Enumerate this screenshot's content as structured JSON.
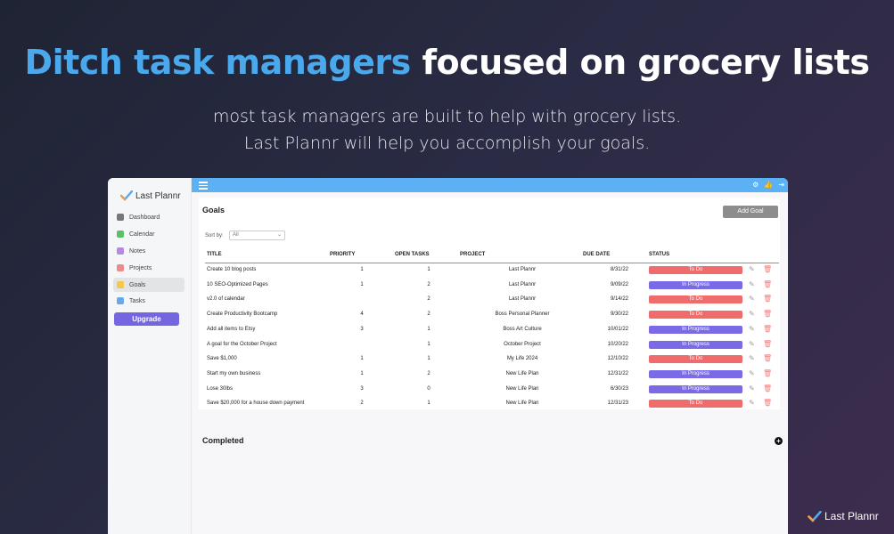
{
  "hero": {
    "headline_accent": "Ditch task managers",
    "headline_rest": "focused on grocery lists",
    "subline_1": "most task managers are built to help with grocery lists.",
    "subline_2": "Last Plannr will help you accomplish your goals."
  },
  "app": {
    "logo_text": "Last Plannr",
    "sidebar": {
      "items": [
        {
          "label": "Dashboard",
          "icon": "home-icon",
          "color": "#777777"
        },
        {
          "label": "Calendar",
          "icon": "calendar-icon",
          "color": "#5cc06a"
        },
        {
          "label": "Notes",
          "icon": "notes-icon",
          "color": "#b48be0"
        },
        {
          "label": "Projects",
          "icon": "projects-icon",
          "color": "#ef8a8a"
        },
        {
          "label": "Goals",
          "icon": "goals-icon",
          "color": "#f3c94a"
        },
        {
          "label": "Tasks",
          "icon": "tasks-icon",
          "color": "#6aa9e8"
        }
      ],
      "active": "Goals",
      "upgrade_label": "Upgrade"
    },
    "topbar": {
      "icons": [
        "settings-icon",
        "thumbs-up-icon",
        "logout-icon"
      ]
    },
    "goals": {
      "title": "Goals",
      "add_label": "Add Goal",
      "sort_label": "Sort by:",
      "sort_value": "All",
      "columns": {
        "title": "TITLE",
        "priority": "PRIORITY",
        "open_tasks": "OPEN TASKS",
        "project": "PROJECT",
        "due_date": "DUE DATE",
        "status": "STATUS"
      },
      "rows": [
        {
          "title": "Create 10 blog posts",
          "priority": "1",
          "open": "1",
          "project": "Last Plannr",
          "due": "8/31/22",
          "status": "To Do"
        },
        {
          "title": "10 SEO-Optimized Pages",
          "priority": "1",
          "open": "2",
          "project": "Last Plannr",
          "due": "9/09/22",
          "status": "In Progress"
        },
        {
          "title": "v2.0 of calendar",
          "priority": "",
          "open": "2",
          "project": "Last Plannr",
          "due": "9/14/22",
          "status": "To Do"
        },
        {
          "title": "Create Productivity Bootcamp",
          "priority": "4",
          "open": "2",
          "project": "Boss Personal Planner",
          "due": "9/30/22",
          "status": "To Do"
        },
        {
          "title": "Add all items to Etsy",
          "priority": "3",
          "open": "1",
          "project": "Boss Art Culture",
          "due": "10/01/22",
          "status": "In Progress"
        },
        {
          "title": "A goal for the October Project",
          "priority": "",
          "open": "1",
          "project": "October Project",
          "due": "10/20/22",
          "status": "In Progress"
        },
        {
          "title": "Save $1,000",
          "priority": "1",
          "open": "1",
          "project": "My Life 2024",
          "due": "12/10/22",
          "status": "To Do"
        },
        {
          "title": "Start my own business",
          "priority": "1",
          "open": "2",
          "project": "New Life Plan",
          "due": "12/31/22",
          "status": "In Progress"
        },
        {
          "title": "Lose 30lbs",
          "priority": "3",
          "open": "0",
          "project": "New Life Plan",
          "due": "6/30/23",
          "status": "In Progress"
        },
        {
          "title": "Save $20,000 for a house down payment",
          "priority": "2",
          "open": "1",
          "project": "New Life Plan",
          "due": "12/31/23",
          "status": "To Do"
        }
      ],
      "status_colors": {
        "To Do": "#f06b6b",
        "In Progress": "#7b6ae6"
      }
    },
    "completed_label": "Completed"
  },
  "brand": {
    "text": "Last Plannr"
  }
}
